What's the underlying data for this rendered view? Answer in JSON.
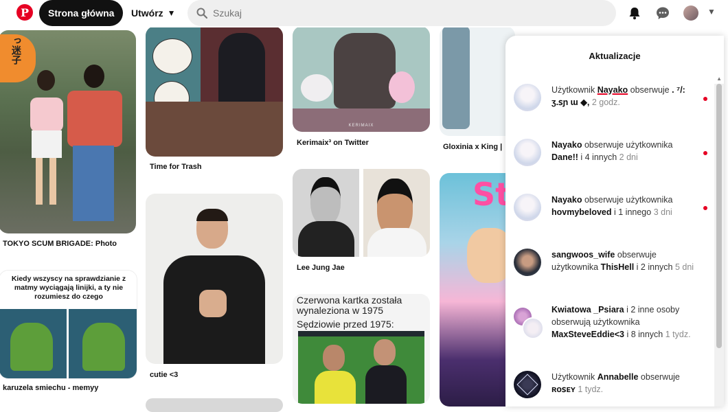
{
  "header": {
    "logo_letter": "P",
    "home_label": "Strona główna",
    "create_label": "Utwórz",
    "search_placeholder": "Szukaj"
  },
  "feed": {
    "col1": {
      "pin1_badge": "っ迷子",
      "pin1_caption": "TOKYO SCUM BRIGADE: Photo",
      "meme_text": "Kiedy wszyscy na sprawdzianie z matmy wyciągają linijki, a ty nie rozumiesz do czego",
      "pin2_caption": "karuzela smiechu - memyy"
    },
    "col2": {
      "pin1_caption": "Time for Trash",
      "pin2_caption": "cutie <3"
    },
    "col3": {
      "pin1_watermark": "KERIMAIX",
      "pin1_caption": "Kerimaix³ on Twitter",
      "pin2_caption": "Lee Jung Jae",
      "card_line1": "Czerwona kartka została wynaleziona w 1975",
      "card_line2": "Sędziowie przed 1975:"
    },
    "col4": {
      "pin1_caption": "Gloxinia x King |",
      "pin2_text": "Star"
    }
  },
  "notifications": {
    "title": "Aktualizacje",
    "items": [
      {
        "pre": "Użytkownik ",
        "user": "Nayako",
        "mid": " obserwuje ",
        "target": ". ⁷/: ʒ.ꜱɲ ɯ ◆, ",
        "post": "",
        "time": "2 godz.",
        "unread": true
      },
      {
        "pre": "",
        "user": "Nayako",
        "mid": " obserwuje użytkownika ",
        "target": "Dane!!",
        "post": " i 4 innych ",
        "time": "2 dni",
        "unread": true
      },
      {
        "pre": "",
        "user": "Nayako",
        "mid": " obserwuje użytkownika ",
        "target": "hovmybeloved",
        "post": " i 1 innego ",
        "time": "3 dni",
        "unread": true
      },
      {
        "pre": "",
        "user": "sangwoos_wife",
        "mid": " obserwuje użytkownika ",
        "target": "ThisHell",
        "post": " i 2 innych ",
        "time": "5 dni",
        "unread": false
      },
      {
        "pre": "",
        "user": "Kwiatowa _Psiara",
        "mid": " i 2 inne osoby obserwują użytkownika ",
        "target": "MaxSteveEddie<3",
        "post": " i 8 innych ",
        "time": "1 tydz.",
        "unread": false
      },
      {
        "pre": "Użytkownik ",
        "user": "Annabelle",
        "mid": " obserwuje ",
        "target": "ʀᴏꜱᴇʏ",
        "post": " ",
        "time": "1 tydz.",
        "unread": false
      }
    ]
  },
  "colors": {
    "brand_red": "#e60023",
    "dark": "#111111",
    "search_bg": "#efefef"
  }
}
